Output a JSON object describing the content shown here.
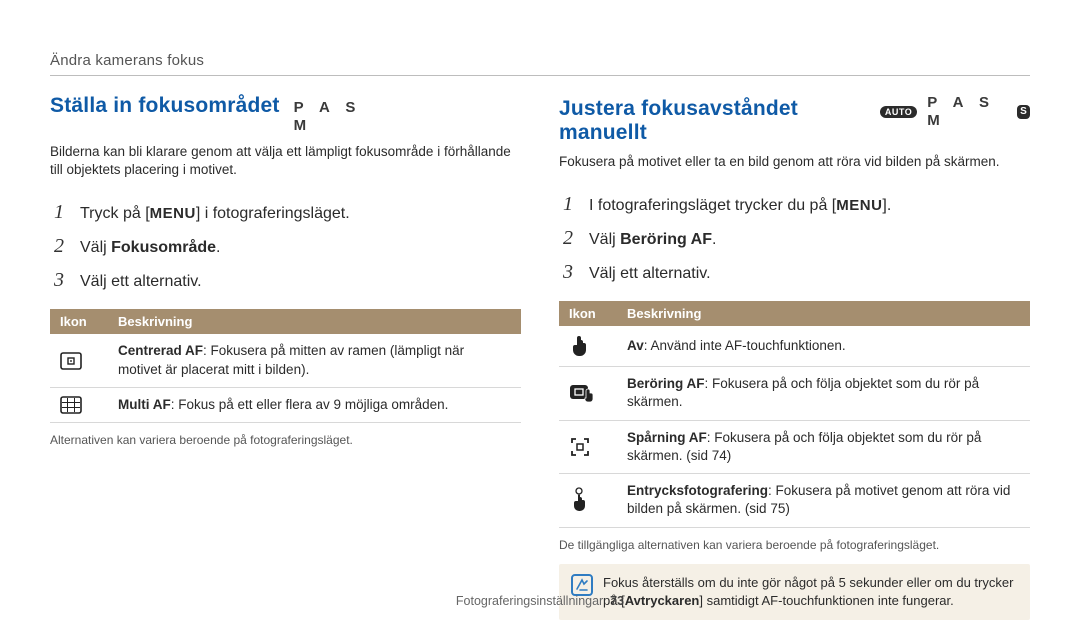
{
  "breadcrumb": "Ändra kamerans fokus",
  "left": {
    "heading": "Ställa in fokusområdet",
    "modes_letters": "P A S M",
    "intro": "Bilderna kan bli klarare genom att välja ett lämpligt fokusområde i förhållande till objektets placering i motivet.",
    "steps": {
      "s1_a": "Tryck på [",
      "s1_menu": "MENU",
      "s1_b": "] i fotograferingsläget.",
      "s2_a": "Välj ",
      "s2_term": "Fokusområde",
      "s2_b": ".",
      "s3": "Välj ett alternativ."
    },
    "table": {
      "th_icon": "Ikon",
      "th_desc": "Beskrivning",
      "rows": [
        {
          "icon": "center-af",
          "title": "Centrerad AF",
          "text": ": Fokusera på mitten av ramen (lämpligt när motivet är placerat mitt i bilden)."
        },
        {
          "icon": "multi-af",
          "title": "Multi AF",
          "text": ": Fokus på ett eller flera av 9 möjliga områden."
        }
      ]
    },
    "footnote": "Alternativen kan variera beroende på fotograferingsläget."
  },
  "right": {
    "heading": "Justera fokusavståndet manuellt",
    "mode_auto": "AUTO",
    "modes_letters": "P A S M",
    "intro": "Fokusera på motivet eller ta en bild genom att röra vid bilden på skärmen.",
    "steps": {
      "s1_a": "I fotograferingsläget trycker du på [",
      "s1_menu": "MENU",
      "s1_b": "].",
      "s2_a": "Välj ",
      "s2_term": "Beröring AF",
      "s2_b": ".",
      "s3": "Välj ett alternativ."
    },
    "table": {
      "th_icon": "Ikon",
      "th_desc": "Beskrivning",
      "rows": [
        {
          "icon": "off",
          "title": "Av",
          "text": ": Använd inte AF-touchfunktionen."
        },
        {
          "icon": "touch-af",
          "title": "Beröring AF",
          "text": ": Fokusera på och följa objektet som du rör på skärmen."
        },
        {
          "icon": "tracking",
          "title": "Spårning AF",
          "text": ": Fokusera på och följa objektet som du rör på skärmen. (sid 74)"
        },
        {
          "icon": "one-touch",
          "title": "Entrycksfotografering",
          "text": ": Fokusera på motivet genom att röra vid bilden på skärmen. (sid 75)"
        }
      ]
    },
    "footnote": "De tillgängliga alternativen kan variera beroende på fotograferingsläget.",
    "callout_a": "Fokus återställs om du inte gör något på 5 sekunder eller om du trycker på [",
    "callout_key": "Avtryckaren",
    "callout_b": "] samtidigt AF-touchfunktionen inte fungerar."
  },
  "footer": {
    "section": "Fotograferingsinställningar",
    "page": "73"
  }
}
